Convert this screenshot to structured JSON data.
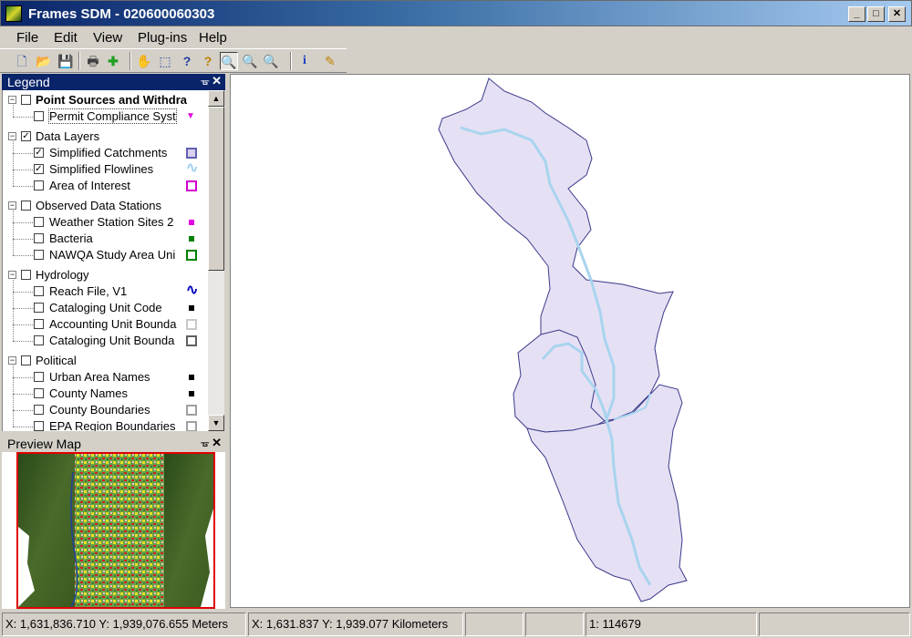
{
  "window": {
    "title": "Frames SDM  - 020600060303",
    "controls": {
      "minimize": "_",
      "maximize": "□",
      "close": "✕"
    }
  },
  "menu": [
    "File",
    "Edit",
    "View",
    "Plug-ins",
    "Help"
  ],
  "toolbar": {
    "buttons": [
      "new-document-icon",
      "open-folder-icon",
      "save-icon",
      "print-icon",
      "add-layer-icon",
      "pan-hand-icon",
      "select-icon",
      "query-help-icon",
      "identify-help-icon",
      "zoom-tool-icon",
      "zoom-in-icon",
      "zoom-out-icon",
      "info-icon",
      "edit-icon"
    ],
    "glyphs": [
      "🗋",
      "📂",
      "💾",
      "🖶",
      "✚",
      "✋",
      "⬚",
      "?",
      "?",
      "🔍",
      "🔍",
      "🔍",
      "i",
      "✎"
    ]
  },
  "legend": {
    "title": "Legend",
    "pin": "ᚗ",
    "close": "✕",
    "groups": [
      {
        "label": "Point Sources  and Withdra",
        "bold": true,
        "checked": false,
        "items": [
          {
            "label": "Permit  Compliance Syst",
            "checked": false,
            "symbol": "triangle",
            "color": "#e000e0"
          }
        ]
      },
      {
        "label": "Data Layers",
        "checked": true,
        "items": [
          {
            "label": "Simplified  Catchments",
            "checked": true,
            "symbol": "square-fill",
            "color": "#6060b0"
          },
          {
            "label": "Simplified  Flowlines",
            "checked": true,
            "symbol": "wave",
            "color": "#a0d0f0"
          },
          {
            "label": "Area  of  Interest",
            "checked": false,
            "symbol": "square-outline",
            "color": "#d000d0"
          }
        ]
      },
      {
        "label": "Observed Data Stations",
        "checked": false,
        "items": [
          {
            "label": "Weather  Station  Sites 2",
            "checked": false,
            "symbol": "dot",
            "color": "#e000e0"
          },
          {
            "label": "Bacteria",
            "checked": false,
            "symbol": "dot",
            "color": "#008000"
          },
          {
            "label": "NAWQA  Study  Area Uni",
            "checked": false,
            "symbol": "square-outline",
            "color": "#008000"
          }
        ]
      },
      {
        "label": "Hydrology",
        "checked": false,
        "items": [
          {
            "label": "Reach File, V1",
            "checked": false,
            "symbol": "wave",
            "color": "#0000c0"
          },
          {
            "label": "Cataloging Unit Code",
            "checked": false,
            "symbol": "dot",
            "color": "#000000"
          },
          {
            "label": "Accounting  Unit Bounda",
            "checked": false,
            "symbol": "square-outline",
            "color": "#c8c8c8"
          },
          {
            "label": "Cataloging  Unit Bounda",
            "checked": false,
            "symbol": "square-outline",
            "color": "#606060"
          }
        ]
      },
      {
        "label": "Political",
        "checked": false,
        "items": [
          {
            "label": "Urban Area Names",
            "checked": false,
            "symbol": "dot",
            "color": "#000000"
          },
          {
            "label": "County Names",
            "checked": false,
            "symbol": "dot",
            "color": "#000000"
          },
          {
            "label": "County Boundaries",
            "checked": false,
            "symbol": "square-outline",
            "color": "#a0a0a0"
          },
          {
            "label": "EPA Region Boundaries",
            "checked": false,
            "symbol": "square-outline",
            "color": "#a0a0a0"
          }
        ]
      }
    ]
  },
  "preview": {
    "title": "Preview Map",
    "pin": "ᚗ",
    "close": "✕"
  },
  "map": {
    "catchment_fill": "#e6e0f4",
    "catchment_stroke": "#3a3a8a",
    "flowline_color": "#a8d4ee"
  },
  "status": {
    "coords_meters": "X: 1,631,836.710 Y: 1,939,076.655 Meters",
    "coords_km": "X: 1,631.837 Y: 1,939.077 Kilometers",
    "blank1": "",
    "blank2": "",
    "scale": "1: 114679",
    "blank3": ""
  }
}
